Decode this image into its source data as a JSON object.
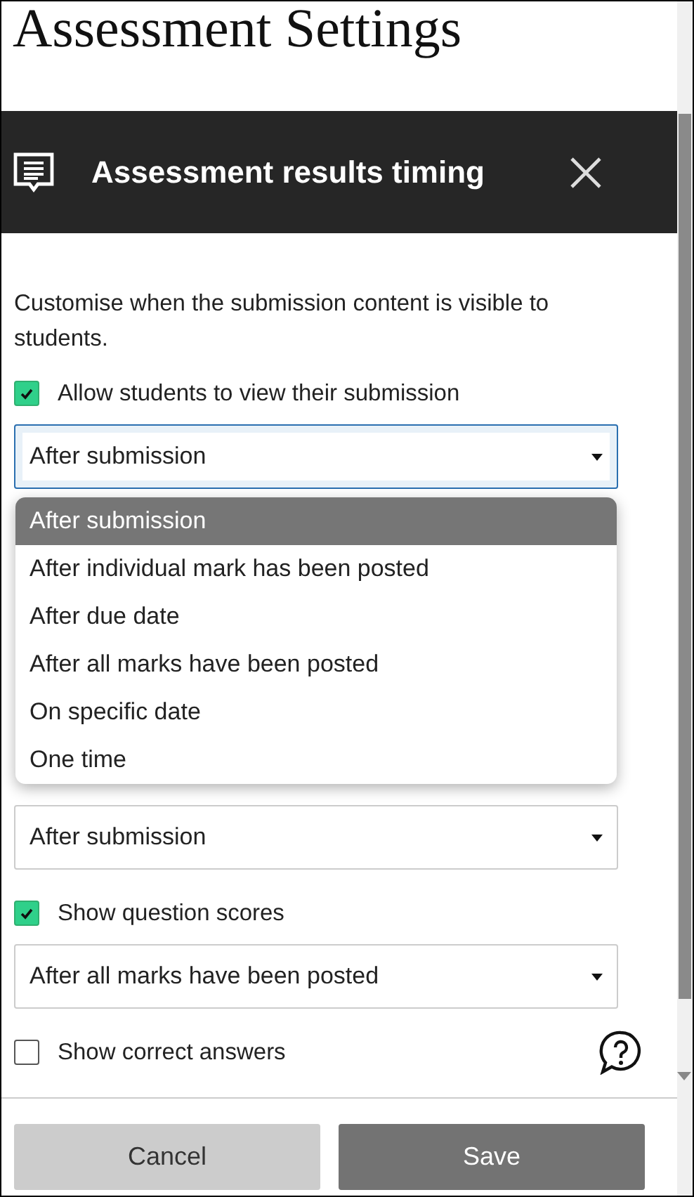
{
  "page_title": "Assessment Settings",
  "panel": {
    "title": "Assessment results timing",
    "description": "Customise when the submission content is visible to students.",
    "settings": [
      {
        "kind": "checkbox",
        "label": "Allow students to view their submission",
        "checked": true
      },
      {
        "kind": "select",
        "value": "After submission",
        "focused": true
      },
      {
        "kind": "hidden"
      },
      {
        "kind": "select",
        "value": "After submission",
        "focused": false
      },
      {
        "kind": "checkbox",
        "label": "Show question scores",
        "checked": true
      },
      {
        "kind": "select",
        "value": "After all marks have been posted",
        "focused": false
      },
      {
        "kind": "checkbox",
        "label": "Show correct answers",
        "checked": false,
        "help": true
      }
    ]
  },
  "dropdown": {
    "options": [
      {
        "label": "After submission",
        "selected": true
      },
      {
        "label": "After individual mark has been posted",
        "selected": false
      },
      {
        "label": "After due date",
        "selected": false
      },
      {
        "label": "After all marks have been posted",
        "selected": false
      },
      {
        "label": "On specific date",
        "selected": false
      },
      {
        "label": "One time",
        "selected": false
      }
    ]
  },
  "buttons": [
    {
      "label": "Cancel",
      "kind": "secondary"
    },
    {
      "label": "Save",
      "kind": "primary"
    }
  ]
}
